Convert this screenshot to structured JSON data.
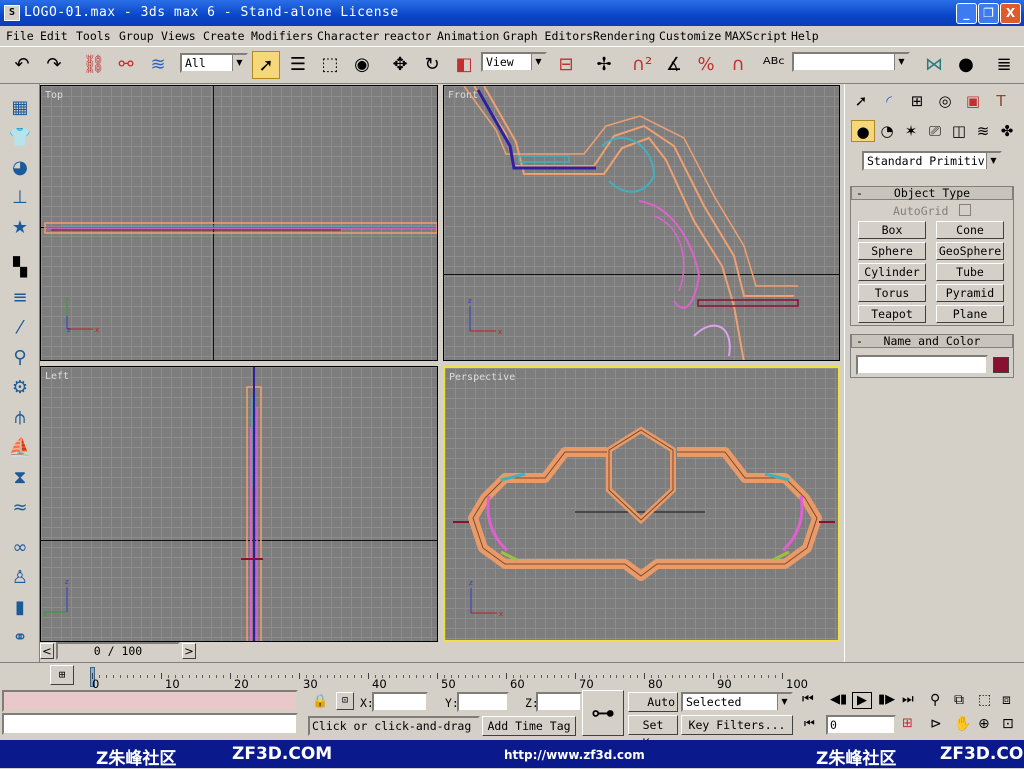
{
  "window": {
    "icon": "S",
    "title": "LOGO-01.max - 3ds max 6 - Stand-alone License",
    "buttons": [
      "_",
      "❐",
      "X"
    ]
  },
  "menu": [
    "File",
    "Edit",
    "Tools",
    "Group",
    "Views",
    "Create",
    "Modifiers",
    "Character",
    "reactor",
    "Animation",
    "Graph Editors",
    "Rendering",
    "Customize",
    "MAXScript",
    "Help"
  ],
  "toolbar": {
    "selection_filter": "All",
    "reference_coord": "View",
    "named_selection": ""
  },
  "viewports": {
    "top": "Top",
    "front": "Front",
    "left": "Left",
    "perspective": "Perspective"
  },
  "command_panel": {
    "category": "Standard Primitiv",
    "object_type_title": "Object Type",
    "autogrid": "AutoGrid",
    "primitives": [
      "Box",
      "Cone",
      "Sphere",
      "GeoSphere",
      "Cylinder",
      "Tube",
      "Torus",
      "Pyramid",
      "Teapot",
      "Plane"
    ],
    "name_color_title": "Name and Color",
    "name_value": "",
    "object_color": "#8a1030",
    "minus": "-"
  },
  "timeline": {
    "frame_display": "0 / 100",
    "ticks": [
      "0",
      "10",
      "20",
      "30",
      "40",
      "50",
      "60",
      "70",
      "80",
      "90",
      "100"
    ],
    "current_frame": 0,
    "total_frames": 100
  },
  "status": {
    "x_label": "X:",
    "y_label": "Y:",
    "z_label": "Z:",
    "x_value": "",
    "y_value": "",
    "z_value": "",
    "prompt": "Click or click-and-drag",
    "add_time_tag": "Add Time Tag",
    "auto_key": "Auto Key",
    "set_key": "Set Key",
    "key_mode": "Selected",
    "key_filters": "Key Filters...",
    "frame_field": "0"
  },
  "footer": {
    "left_logo": "Z朱峰社区",
    "left_site": "ZF3D.COM",
    "url": "http://www.zf3d.com",
    "right_logo": "Z朱峰社区",
    "right_site": "ZF3D.COM"
  },
  "colors": {
    "title_bar": "#0a46c8",
    "viewport_bg": "#7d7d7d",
    "active_viewport_border": "#f0e040",
    "logo_orange": "#f0a070",
    "logo_pink": "#e060d0",
    "logo_cyan": "#40b0c0",
    "logo_purple": "#3020a0"
  }
}
